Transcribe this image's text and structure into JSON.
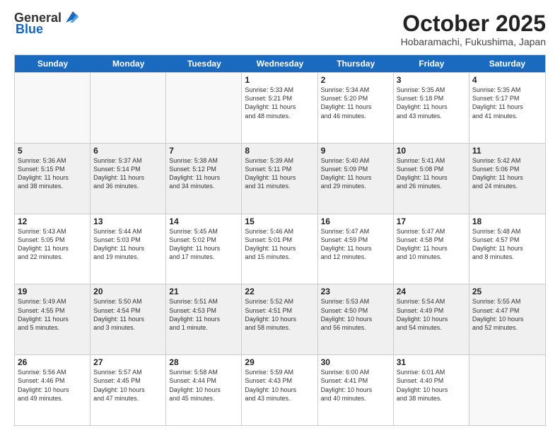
{
  "header": {
    "logo": {
      "general": "General",
      "blue": "Blue"
    },
    "title": "October 2025",
    "location": "Hobaramachi, Fukushima, Japan"
  },
  "calendar": {
    "days_of_week": [
      "Sunday",
      "Monday",
      "Tuesday",
      "Wednesday",
      "Thursday",
      "Friday",
      "Saturday"
    ],
    "weeks": [
      [
        {
          "day": "",
          "empty": true
        },
        {
          "day": "",
          "empty": true
        },
        {
          "day": "",
          "empty": true
        },
        {
          "day": "1",
          "sunrise": "5:33 AM",
          "sunset": "5:21 PM",
          "daylight": "11 hours and 48 minutes."
        },
        {
          "day": "2",
          "sunrise": "5:34 AM",
          "sunset": "5:20 PM",
          "daylight": "11 hours and 46 minutes."
        },
        {
          "day": "3",
          "sunrise": "5:35 AM",
          "sunset": "5:18 PM",
          "daylight": "11 hours and 43 minutes."
        },
        {
          "day": "4",
          "sunrise": "5:35 AM",
          "sunset": "5:17 PM",
          "daylight": "11 hours and 41 minutes."
        }
      ],
      [
        {
          "day": "5",
          "sunrise": "5:36 AM",
          "sunset": "5:15 PM",
          "daylight": "11 hours and 38 minutes."
        },
        {
          "day": "6",
          "sunrise": "5:37 AM",
          "sunset": "5:14 PM",
          "daylight": "11 hours and 36 minutes."
        },
        {
          "day": "7",
          "sunrise": "5:38 AM",
          "sunset": "5:12 PM",
          "daylight": "11 hours and 34 minutes."
        },
        {
          "day": "8",
          "sunrise": "5:39 AM",
          "sunset": "5:11 PM",
          "daylight": "11 hours and 31 minutes."
        },
        {
          "day": "9",
          "sunrise": "5:40 AM",
          "sunset": "5:09 PM",
          "daylight": "11 hours and 29 minutes."
        },
        {
          "day": "10",
          "sunrise": "5:41 AM",
          "sunset": "5:08 PM",
          "daylight": "11 hours and 26 minutes."
        },
        {
          "day": "11",
          "sunrise": "5:42 AM",
          "sunset": "5:06 PM",
          "daylight": "11 hours and 24 minutes."
        }
      ],
      [
        {
          "day": "12",
          "sunrise": "5:43 AM",
          "sunset": "5:05 PM",
          "daylight": "11 hours and 22 minutes."
        },
        {
          "day": "13",
          "sunrise": "5:44 AM",
          "sunset": "5:03 PM",
          "daylight": "11 hours and 19 minutes."
        },
        {
          "day": "14",
          "sunrise": "5:45 AM",
          "sunset": "5:02 PM",
          "daylight": "11 hours and 17 minutes."
        },
        {
          "day": "15",
          "sunrise": "5:46 AM",
          "sunset": "5:01 PM",
          "daylight": "11 hours and 15 minutes."
        },
        {
          "day": "16",
          "sunrise": "5:47 AM",
          "sunset": "4:59 PM",
          "daylight": "11 hours and 12 minutes."
        },
        {
          "day": "17",
          "sunrise": "5:47 AM",
          "sunset": "4:58 PM",
          "daylight": "11 hours and 10 minutes."
        },
        {
          "day": "18",
          "sunrise": "5:48 AM",
          "sunset": "4:57 PM",
          "daylight": "11 hours and 8 minutes."
        }
      ],
      [
        {
          "day": "19",
          "sunrise": "5:49 AM",
          "sunset": "4:55 PM",
          "daylight": "11 hours and 5 minutes."
        },
        {
          "day": "20",
          "sunrise": "5:50 AM",
          "sunset": "4:54 PM",
          "daylight": "11 hours and 3 minutes."
        },
        {
          "day": "21",
          "sunrise": "5:51 AM",
          "sunset": "4:53 PM",
          "daylight": "11 hours and 1 minute."
        },
        {
          "day": "22",
          "sunrise": "5:52 AM",
          "sunset": "4:51 PM",
          "daylight": "10 hours and 58 minutes."
        },
        {
          "day": "23",
          "sunrise": "5:53 AM",
          "sunset": "4:50 PM",
          "daylight": "10 hours and 56 minutes."
        },
        {
          "day": "24",
          "sunrise": "5:54 AM",
          "sunset": "4:49 PM",
          "daylight": "10 hours and 54 minutes."
        },
        {
          "day": "25",
          "sunrise": "5:55 AM",
          "sunset": "4:47 PM",
          "daylight": "10 hours and 52 minutes."
        }
      ],
      [
        {
          "day": "26",
          "sunrise": "5:56 AM",
          "sunset": "4:46 PM",
          "daylight": "10 hours and 49 minutes."
        },
        {
          "day": "27",
          "sunrise": "5:57 AM",
          "sunset": "4:45 PM",
          "daylight": "10 hours and 47 minutes."
        },
        {
          "day": "28",
          "sunrise": "5:58 AM",
          "sunset": "4:44 PM",
          "daylight": "10 hours and 45 minutes."
        },
        {
          "day": "29",
          "sunrise": "5:59 AM",
          "sunset": "4:43 PM",
          "daylight": "10 hours and 43 minutes."
        },
        {
          "day": "30",
          "sunrise": "6:00 AM",
          "sunset": "4:41 PM",
          "daylight": "10 hours and 40 minutes."
        },
        {
          "day": "31",
          "sunrise": "6:01 AM",
          "sunset": "4:40 PM",
          "daylight": "10 hours and 38 minutes."
        },
        {
          "day": "",
          "empty": true
        }
      ]
    ]
  }
}
